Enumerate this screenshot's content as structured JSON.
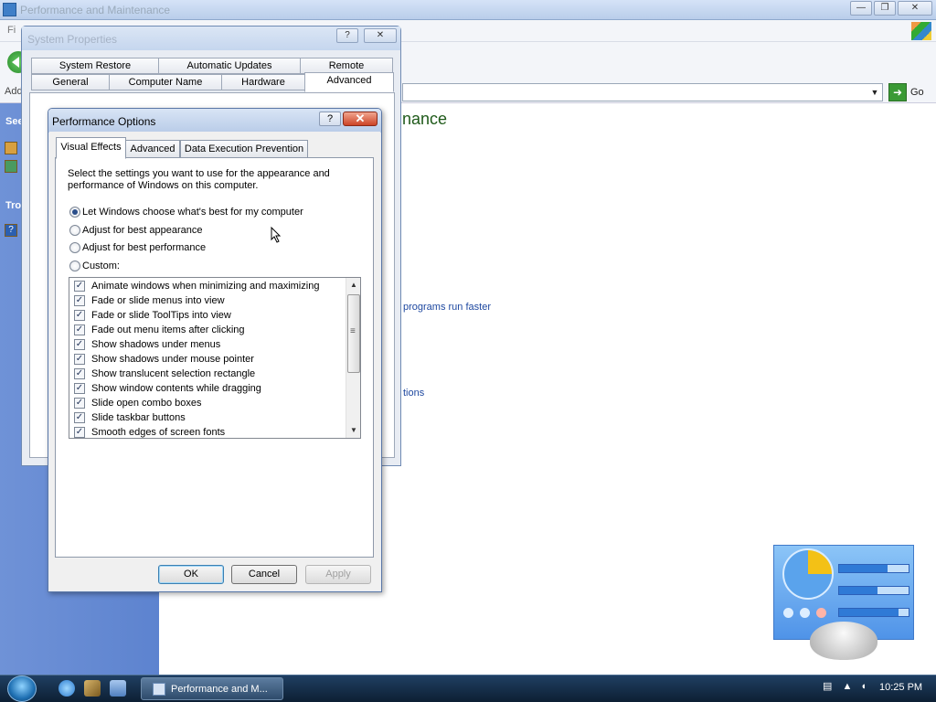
{
  "background_window": {
    "title": "Performance and Maintenance",
    "menu_first": "Fi",
    "address_label": "Add",
    "go_label": "Go",
    "left_panel": {
      "see_also_header": "See",
      "troubleshoot_header": "Tro"
    },
    "main_heading": "nance",
    "links": [
      "programs run faster",
      "tions"
    ]
  },
  "system_properties": {
    "title": "System Properties",
    "tabs_row1": [
      "System Restore",
      "Automatic Updates",
      "Remote"
    ],
    "tabs_row2": [
      "General",
      "Computer Name",
      "Hardware",
      "Advanced"
    ],
    "selected_tab": "Advanced",
    "help_glyph": "?",
    "close_glyph": "✕"
  },
  "performance_options": {
    "title": "Performance Options",
    "help_glyph": "?",
    "close_glyph": "✕",
    "tabs": [
      "Visual Effects",
      "Advanced",
      "Data Execution Prevention"
    ],
    "selected_tab": "Visual Effects",
    "description": "Select the settings you want to use for the appearance and performance of Windows on this computer.",
    "options": [
      {
        "label": "Let Windows choose what's best for my computer",
        "selected": true
      },
      {
        "label": "Adjust for best appearance",
        "selected": false
      },
      {
        "label": "Adjust for best performance",
        "selected": false
      },
      {
        "label": "Custom:",
        "selected": false
      }
    ],
    "effects": [
      {
        "label": "Animate windows when minimizing and maximizing",
        "checked": true
      },
      {
        "label": "Fade or slide menus into view",
        "checked": true
      },
      {
        "label": "Fade or slide ToolTips into view",
        "checked": true
      },
      {
        "label": "Fade out menu items after clicking",
        "checked": true
      },
      {
        "label": "Show shadows under menus",
        "checked": true
      },
      {
        "label": "Show shadows under mouse pointer",
        "checked": true
      },
      {
        "label": "Show translucent selection rectangle",
        "checked": true
      },
      {
        "label": "Show window contents while dragging",
        "checked": true
      },
      {
        "label": "Slide open combo boxes",
        "checked": true
      },
      {
        "label": "Slide taskbar buttons",
        "checked": true
      },
      {
        "label": "Smooth edges of screen fonts",
        "checked": true
      }
    ],
    "check_glyph": "✓",
    "scroll_up_glyph": "▲",
    "scroll_down_glyph": "▼",
    "buttons": {
      "ok": "OK",
      "cancel": "Cancel",
      "apply": "Apply"
    }
  },
  "taskbar": {
    "task_button_label": "Performance and M...",
    "clock": "10:25 PM"
  }
}
